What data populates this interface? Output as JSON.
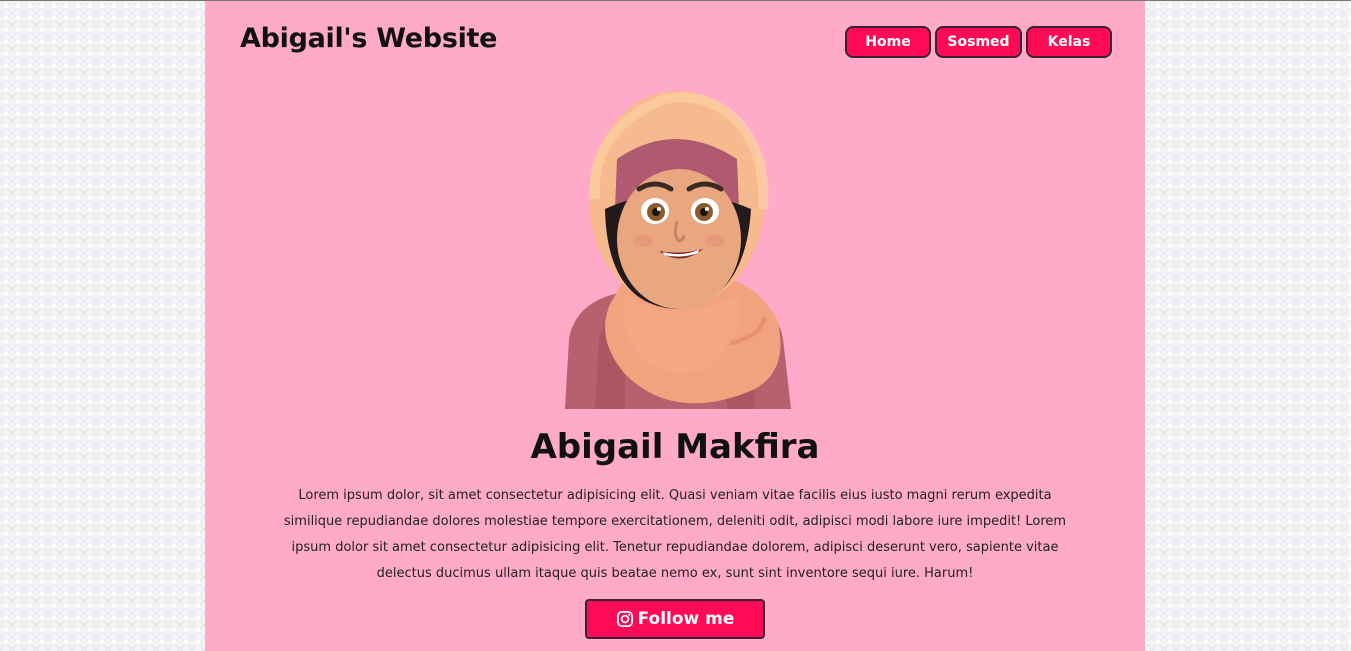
{
  "header": {
    "site_title": "Abigail's Website",
    "nav": [
      {
        "label": "Home"
      },
      {
        "label": "Sosmed"
      },
      {
        "label": "Kelas"
      }
    ]
  },
  "profile": {
    "name": "Abigail Makfira",
    "bio": "Lorem ipsum dolor, sit amet consectetur adipisicing elit. Quasi veniam vitae facilis eius iusto magni rerum expedita similique repudiandae dolores molestiae tempore exercitationem, deleniti odit, adipisci modi labore iure impedit! Lorem ipsum dolor sit amet consectetur adipisicing elit. Tenetur repudiandae dolorem, adipisci deserunt vero, sapiente vitae delectus ducimus ullam itaque quis beatae nemo ex, sunt sint inventore sequi iure. Harum!",
    "follow_label": "Follow me",
    "follow_icon": "instagram-icon",
    "avatar": "hijab-avatar"
  },
  "colors": {
    "page_bg": "#ffaac9",
    "accent": "#ff0a56",
    "button_border": "#3a2230",
    "text": "#111111"
  }
}
